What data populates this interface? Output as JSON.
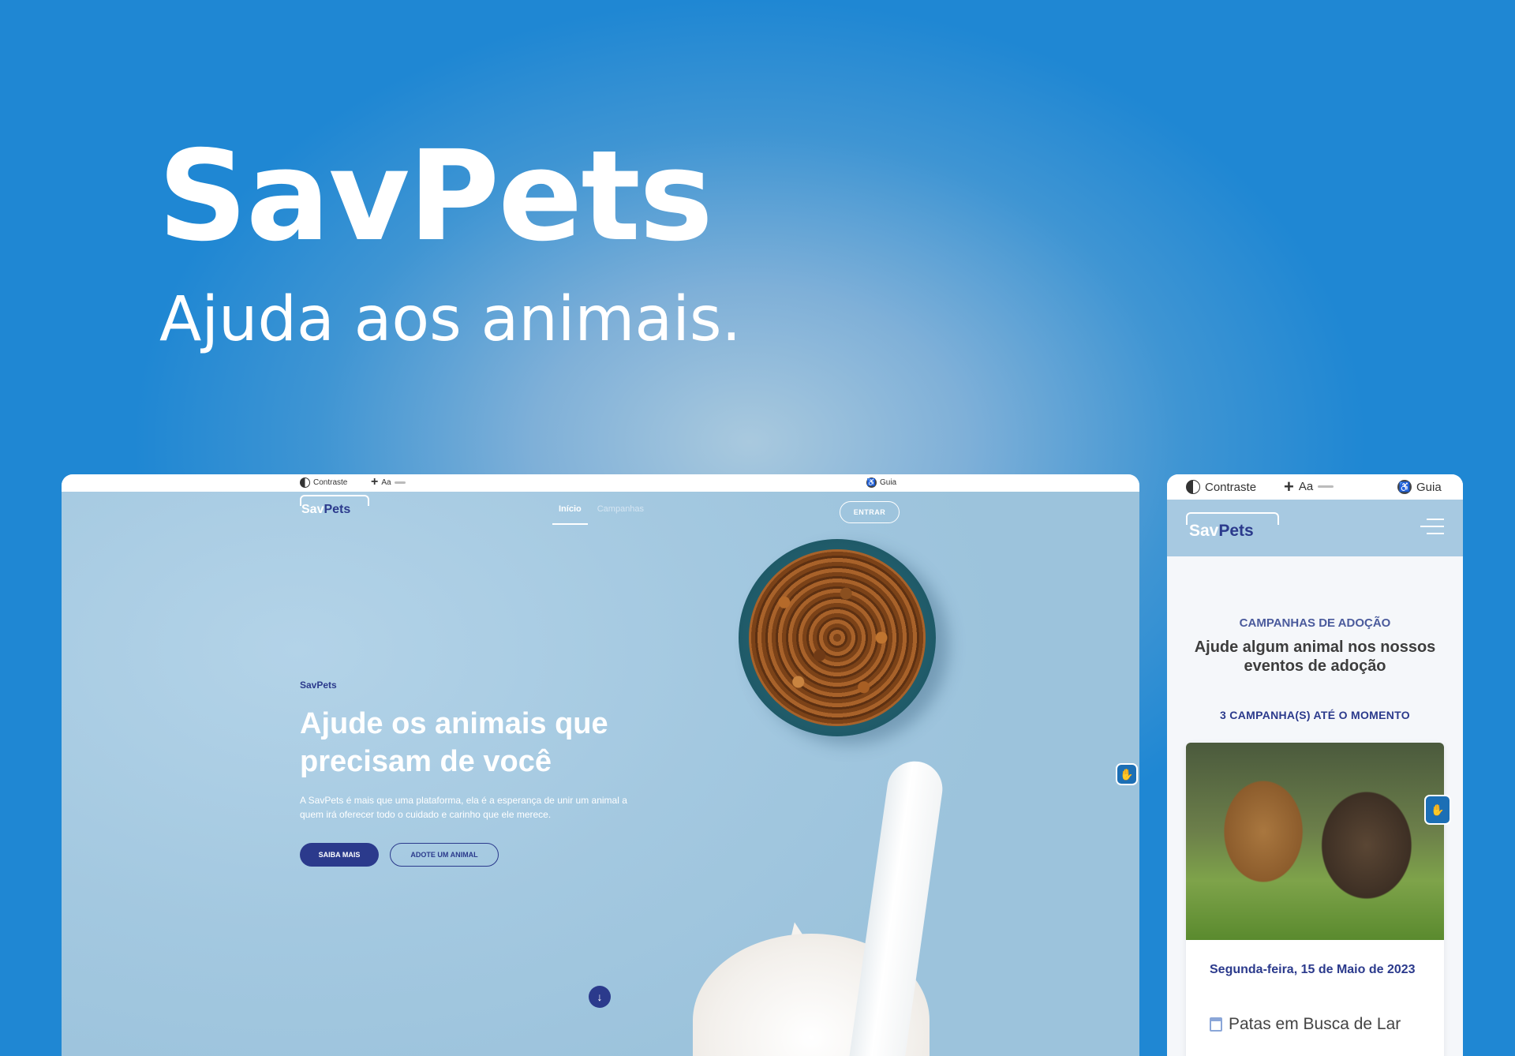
{
  "hero": {
    "title": "SavPets",
    "subtitle": "Ajuda aos animais."
  },
  "desktop": {
    "a11y": {
      "contrast": "Contraste",
      "font_size": "Aa",
      "guide": "Guia"
    },
    "logo": {
      "sav": "Sav",
      "pets": "Pets"
    },
    "nav": {
      "home": "Início",
      "campaigns": "Campanhas"
    },
    "login": "ENTRAR",
    "brand_label": "SavPets",
    "headline": "Ajude os animais que precisam de você",
    "description": "A SavPets é mais que uma plataforma, ela é a esperança de unir um animal a quem irá oferecer todo o cuidado e carinho que ele merece.",
    "btn_learn": "SAIBA MAIS",
    "btn_adopt": "ADOTE UM ANIMAL"
  },
  "mobile": {
    "a11y": {
      "contrast": "Contraste",
      "font_size": "Aa",
      "guide": "Guia"
    },
    "logo": {
      "sav": "Sav",
      "pets": "Pets"
    },
    "kicker": "CAMPANHAS DE ADOÇÃO",
    "title": "Ajude algum animal nos nossos eventos de adoção",
    "count": "3 CAMPANHA(S) ATÉ O MOMENTO",
    "card": {
      "date": "Segunda-feira, 15 de Maio de 2023",
      "event": "Patas em Busca de Lar"
    }
  },
  "colors": {
    "brand_navy": "#2b3a8c",
    "sky": "#a7c9e1",
    "background": "#1f87d3"
  }
}
